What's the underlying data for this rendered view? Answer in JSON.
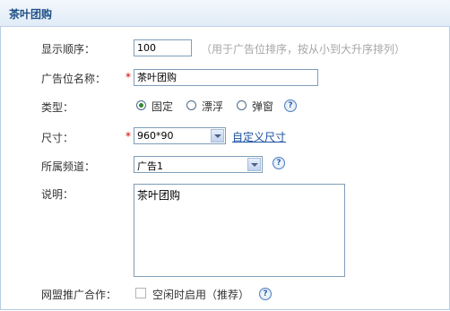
{
  "header": {
    "title": "茶叶团购"
  },
  "form": {
    "order": {
      "label": "显示顺序：",
      "value": "100",
      "hint": "（用于广告位排序，按从小到大升序排列）"
    },
    "name": {
      "label": "广告位名称：",
      "required": "*",
      "value": "茶叶团购"
    },
    "type": {
      "label": "类型：",
      "options": [
        {
          "label": "固定",
          "checked": true
        },
        {
          "label": "漂浮",
          "checked": false
        },
        {
          "label": "弹窗",
          "checked": false
        }
      ],
      "help": "?"
    },
    "size": {
      "label": "尺寸：",
      "required": "*",
      "value": "960*90",
      "custom_link": "自定义尺寸"
    },
    "channel": {
      "label": "所属频道：",
      "value": "广告1",
      "help": "?"
    },
    "description": {
      "label": "说明：",
      "value": "茶叶团购"
    },
    "union": {
      "label": "网盟推广合作：",
      "checkbox_label": "空闲时启用（推荐）",
      "checked": false,
      "help": "?"
    }
  }
}
